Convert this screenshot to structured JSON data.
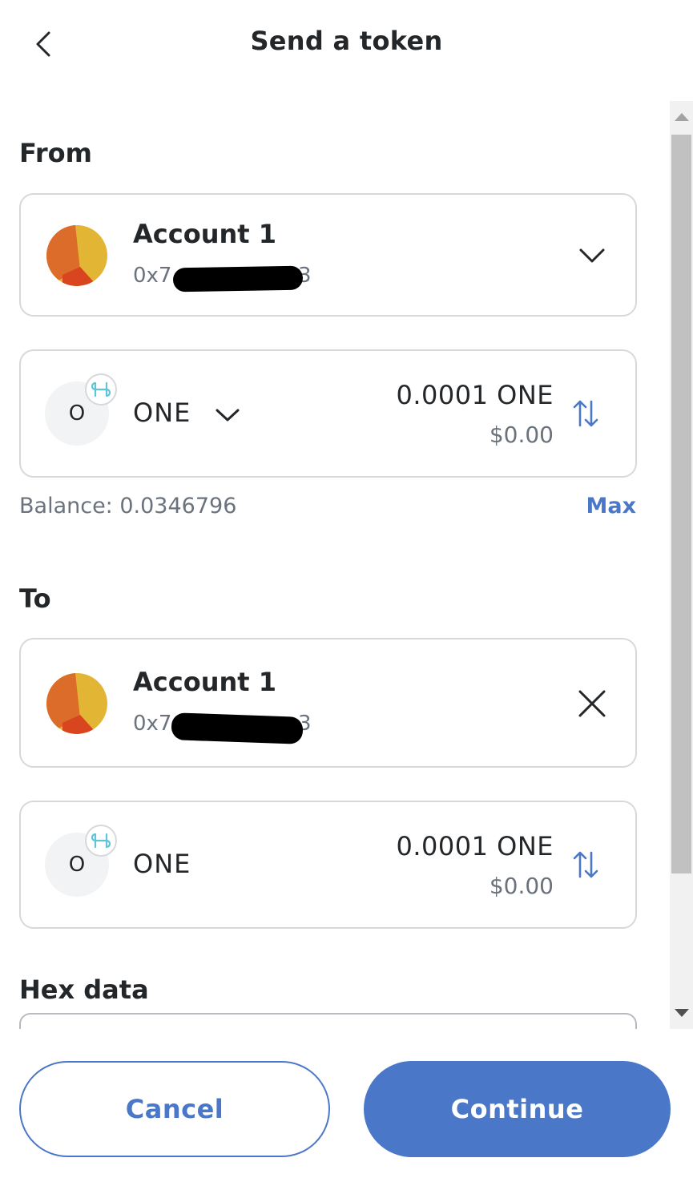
{
  "header": {
    "title": "Send a token",
    "back_icon": "chevron-left-icon"
  },
  "from": {
    "label": "From",
    "account": {
      "name": "Account 1",
      "address_prefix": "0x7",
      "address_suffix": "3",
      "chevron_icon": "chevron-down-icon"
    },
    "asset": {
      "icon_letter": "O",
      "network_icon": "harmony-network-icon",
      "symbol": "ONE",
      "amount": "0.0001 ONE",
      "fiat": "$0.00",
      "swap_icon": "swap-arrows-icon"
    },
    "balance_label": "Balance: 0.0346796",
    "max_label": "Max"
  },
  "to": {
    "label": "To",
    "account": {
      "name": "Account 1",
      "address_prefix": "0x7",
      "address_suffix": "3",
      "close_icon": "close-icon"
    },
    "asset": {
      "icon_letter": "O",
      "network_icon": "harmony-network-icon",
      "symbol": "ONE",
      "amount": "0.0001 ONE",
      "fiat": "$0.00",
      "swap_icon": "swap-arrows-icon"
    }
  },
  "hex_data": {
    "label": "Hex data"
  },
  "footer": {
    "cancel_label": "Cancel",
    "continue_label": "Continue"
  },
  "colors": {
    "primary": "#4a77c7",
    "border": "#d6d9dc",
    "muted_text": "#6a737d"
  }
}
